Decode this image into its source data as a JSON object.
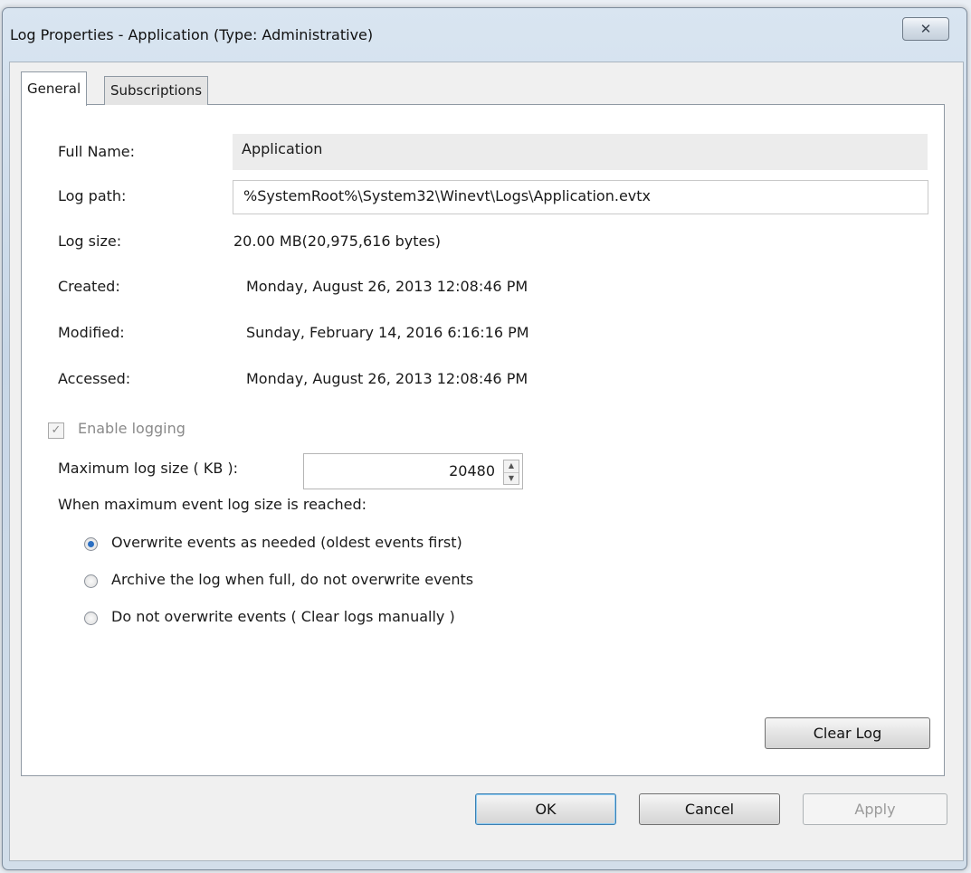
{
  "window": {
    "title": "Log Properties - Application (Type: Administrative)",
    "close_glyph": "✕"
  },
  "tabs": [
    {
      "label": "General",
      "active": true
    },
    {
      "label": "Subscriptions",
      "active": false
    }
  ],
  "fields": {
    "full_name_label": "Full Name:",
    "full_name": "Application",
    "log_path_label": "Log path:",
    "log_path": "%SystemRoot%\\System32\\Winevt\\Logs\\Application.evtx",
    "log_size_label": "Log size:",
    "log_size": "20.00 MB(20,975,616 bytes)",
    "created_label": "Created:",
    "created": "Monday, August 26, 2013 12:08:46 PM",
    "modified_label": "Modified:",
    "modified": "Sunday, February 14, 2016 6:16:16 PM",
    "accessed_label": "Accessed:",
    "accessed": "Monday, August 26, 2013 12:08:46 PM"
  },
  "logging": {
    "enable_label": "Enable logging",
    "enabled": true,
    "checkmark": "✓",
    "max_size_label": "Maximum log size ( KB ):",
    "max_size_value": "20480",
    "spin_up": "▲",
    "spin_down": "▼",
    "policy_label": "When maximum event log size is reached:",
    "options": [
      {
        "label": "Overwrite events as needed (oldest events first)",
        "selected": true
      },
      {
        "label": "Archive the log when full, do not overwrite events",
        "selected": false
      },
      {
        "label": "Do not overwrite events ( Clear logs manually )",
        "selected": false
      }
    ]
  },
  "buttons": {
    "clear_log": "Clear Log",
    "ok": "OK",
    "cancel": "Cancel",
    "apply": "Apply"
  },
  "colors": {
    "accent": "#2b6fc2",
    "frame": "#c8d7e7"
  }
}
